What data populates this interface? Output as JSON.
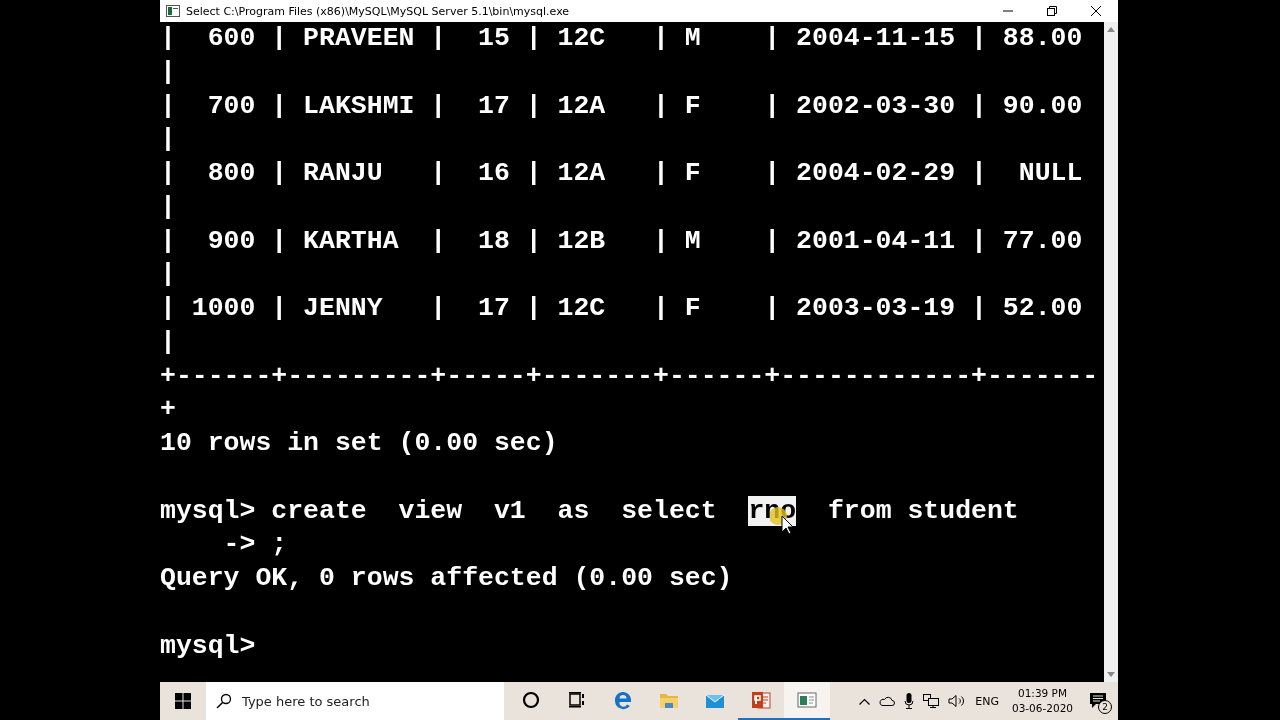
{
  "window": {
    "title": "Select C:\\Program Files (x86)\\MySQL\\MySQL Server 5.1\\bin\\mysql.exe"
  },
  "console": {
    "lines": [
      {
        "text": "|  600 | PRAVEEN |  15 | 12C   | M    | 2004-11-15 | 88.00"
      },
      {
        "text": "|"
      },
      {
        "text": "|  700 | LAKSHMI |  17 | 12A   | F    | 2002-03-30 | 90.00"
      },
      {
        "text": "|"
      },
      {
        "text": "|  800 | RANJU   |  16 | 12A   | F    | 2004-02-29 |  NULL"
      },
      {
        "text": "|"
      },
      {
        "text": "|  900 | KARTHA  |  18 | 12B   | M    | 2001-04-11 | 77.00"
      },
      {
        "text": "|"
      },
      {
        "text": "| 1000 | JENNY   |  17 | 12C   | F    | 2003-03-19 | 52.00"
      },
      {
        "text": "|"
      },
      {
        "text": "+------+---------+-----+-------+------+------------+-------"
      },
      {
        "text": "+"
      },
      {
        "text": "10 rows in set (0.00 sec)"
      },
      {
        "kind": "blank"
      },
      {
        "segments": [
          {
            "text": "mysql> create  view  v1  as  select  ",
            "selected": false
          },
          {
            "text": "rno",
            "selected": true
          },
          {
            "text": "  from student",
            "selected": false
          }
        ]
      },
      {
        "text": "    -> ;"
      },
      {
        "text": "Query OK, 0 rows affected (0.00 sec)"
      },
      {
        "kind": "blank"
      },
      {
        "text": "mysql>"
      }
    ]
  },
  "taskbar": {
    "search": {
      "placeholder": "Type here to search"
    },
    "apps": [
      {
        "kind": "cortana",
        "running": false,
        "selected": false
      },
      {
        "kind": "taskview",
        "running": false,
        "selected": false
      },
      {
        "kind": "edge",
        "running": false,
        "selected": false
      },
      {
        "kind": "explorer",
        "running": false,
        "selected": false
      },
      {
        "kind": "mail",
        "running": false,
        "selected": false
      },
      {
        "kind": "powerpoint",
        "running": true,
        "selected": false
      },
      {
        "kind": "console",
        "running": true,
        "selected": true
      }
    ],
    "language": "ENG",
    "time": "01:39 PM",
    "date": "03-06-2020",
    "notifications": "2"
  }
}
